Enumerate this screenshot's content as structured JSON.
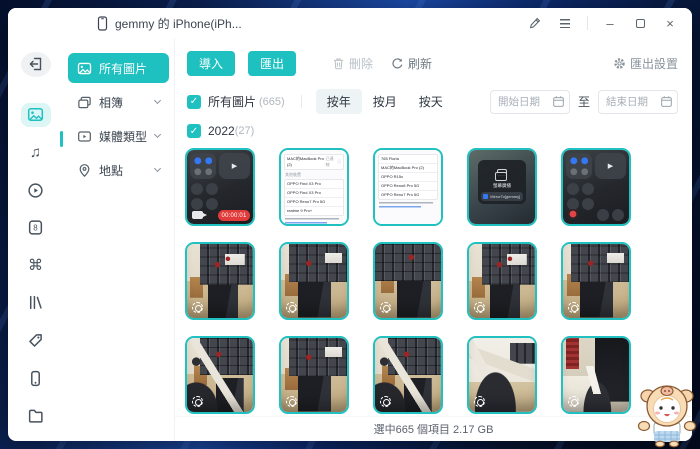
{
  "colors": {
    "accent": "#1ec0c0"
  },
  "titlebar": {
    "title": "gemmy 的 iPhone(iPh..."
  },
  "icons": {
    "music": "♫",
    "apps": "⌘",
    "contacts": "8",
    "check": "✓",
    "play": "▶",
    "info": "ⓘ",
    "minimize": "–",
    "close": "×"
  },
  "nav": {
    "all_photos": "所有圖片",
    "albums": "相簿",
    "media_type": "媒體類型",
    "location": "地點"
  },
  "toolbar": {
    "import": "導入",
    "export": "匯出",
    "delete": "刪除",
    "refresh": "刷新",
    "export_settings": "匯出設置"
  },
  "filter": {
    "all_label": "所有圖片",
    "all_count": "(665)",
    "by_year": "按年",
    "by_month": "按月",
    "by_day": "按天",
    "start_date_placeholder": "開始日期",
    "to": "至",
    "end_date_placeholder": "結束日期"
  },
  "group": {
    "year": "2022",
    "count": "(27)"
  },
  "thumbs": {
    "recording_time": "00:00:01",
    "bt1": {
      "header": "MAC的MacBook Pro (2)",
      "status": "已連線",
      "section": "其他裝置",
      "rows": [
        "OPPO Find X3 Pro",
        "OPPO Find X3 Pro",
        "OPPO Reno7 Pro 5G",
        "realme 9 Pro+"
      ]
    },
    "bt2": {
      "rows": [
        "765 Floria",
        "MAC的MacBook Pro (2)",
        "OPPO R15x",
        "OPPO Reno6 Pro 5G",
        "OPPO Reno7 Pro 5G"
      ]
    },
    "broadcast": {
      "title": "螢幕廣播",
      "row": "MirrorTo[gemmy]"
    }
  },
  "statusbar": {
    "text": "選中665 個項目 2.17 GB"
  }
}
